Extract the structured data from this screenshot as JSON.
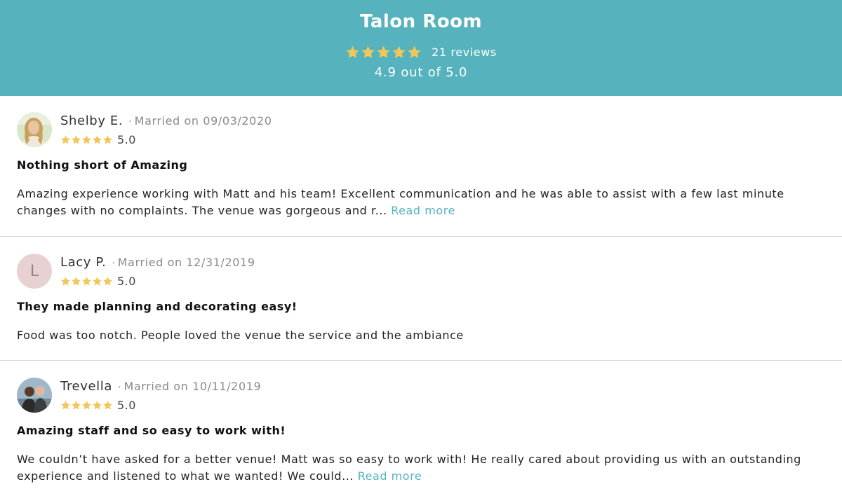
{
  "venue": {
    "name": "Talon Room",
    "star_rating": 5,
    "reviews_count": "21 reviews",
    "average": "4.9 out of 5.0"
  },
  "colors": {
    "header_bg": "#56b3bd",
    "star": "#f1c75b",
    "link": "#56b3bd"
  },
  "reviews": [
    {
      "name": "Shelby E.",
      "separator": "·",
      "married": "Married on 09/03/2020",
      "stars": 5,
      "score": "5.0",
      "title": "Nothing short of Amazing",
      "body": "Amazing experience working with Matt and his team! Excellent communication and he was able to assist with a few last minute changes with no complaints. The venue was gorgeous and r...",
      "read_more": "Read more",
      "avatar": "photo-avatar"
    },
    {
      "name": "Lacy P.",
      "separator": "·",
      "married": "Married on 12/31/2019",
      "stars": 5,
      "score": "5.0",
      "title": "They made planning and decorating easy!",
      "body": "Food was too notch. People loved the venue the service and the ambiance",
      "avatar_initial": "L"
    },
    {
      "name": "Trevella",
      "separator": "·",
      "married": "Married on 10/11/2019",
      "stars": 5,
      "score": "5.0",
      "title": "Amazing staff and so easy to work with!",
      "body": "We couldn’t have asked for a better venue! Matt was so easy to work with! He really cared about providing us with an outstanding experience and listened to what we wanted! We could...",
      "read_more": "Read more",
      "avatar": "photo-avatar"
    }
  ]
}
